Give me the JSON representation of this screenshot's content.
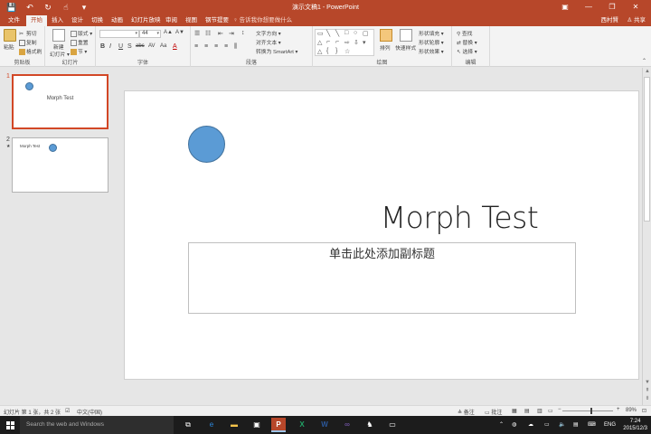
{
  "titlebar": {
    "title": "演示文稿1 - PowerPoint",
    "qat": [
      {
        "icon": "save-icon",
        "glyph": "💾"
      },
      {
        "icon": "undo-icon",
        "glyph": "↶"
      },
      {
        "icon": "redo-icon",
        "glyph": "↻"
      },
      {
        "icon": "touch-mode-icon",
        "glyph": "☝"
      },
      {
        "icon": "customize-qat-icon",
        "glyph": "▾"
      }
    ],
    "window_buttons": {
      "options": "▣",
      "minimize": "—",
      "restore": "❐",
      "close": "✕"
    }
  },
  "tabs": [
    {
      "label": "文件",
      "active": false
    },
    {
      "label": "开始",
      "active": true
    },
    {
      "label": "插入",
      "active": false
    },
    {
      "label": "设计",
      "active": false
    },
    {
      "label": "切换",
      "active": false
    },
    {
      "label": "动画",
      "active": false
    },
    {
      "label": "幻灯片放映",
      "active": false
    },
    {
      "label": "审阅",
      "active": false
    },
    {
      "label": "视图",
      "active": false
    },
    {
      "label": "钢节提要",
      "active": false
    }
  ],
  "tellme": "♀ 告诉我你想要做什么",
  "user": "西村賢",
  "share": "♙ 共享",
  "ribbon": {
    "clipboard": {
      "label": "剪贴板",
      "paste": "粘贴",
      "cut": "剪切",
      "copy": "复制",
      "format_painter": "格式刷"
    },
    "slides": {
      "label": "幻灯片",
      "new_slide": "新建",
      "new_slide_2": "幻灯片 ▾",
      "layout": "版式 ▾",
      "reset": "重置",
      "section": "节 ▾"
    },
    "font": {
      "label": "字体",
      "font_name": "",
      "font_size": "44",
      "bold": "B",
      "italic": "I",
      "underline": "U",
      "shadow": "S",
      "strike": "abc",
      "spacing": "AV",
      "case": "Aa",
      "color": "A",
      "grow": "A▲",
      "shrink": "A▼",
      "clear": "A✕"
    },
    "paragraph": {
      "label": "段落",
      "text_direction": "文字方向 ▾",
      "align_text": "对齐文本 ▾",
      "smartart": "转换为 SmartArt ▾"
    },
    "drawing": {
      "label": "绘图",
      "arrange": "排列",
      "quick_styles": "快速样式",
      "shape_fill": "形状填充 ▾",
      "shape_outline": "形状轮廓 ▾",
      "shape_effects": "形状效果 ▾"
    },
    "editing": {
      "label": "编辑",
      "find": "查找",
      "replace": "替换 ▾",
      "select": "选择 ▾"
    }
  },
  "thumbnails": [
    {
      "number": "1",
      "title": "Morph Test"
    },
    {
      "number": "2",
      "title": "Morph Test",
      "star": "★"
    }
  ],
  "slide": {
    "title": "Morph Test",
    "subtitle_placeholder": "单击此处添加副标题"
  },
  "statusbar": {
    "slide_info": "幻灯片 第 1 张，共 2 张",
    "language": "中文(中国)",
    "notes": "备注",
    "comments": "批注",
    "zoom_minus": "−",
    "zoom_plus": "+",
    "zoom": "89%",
    "zoom_level": 0.55
  },
  "taskbar": {
    "search_placeholder": "Search the web and Windows",
    "language": "ENG",
    "time": "7:24",
    "date": "2015/12/3"
  },
  "colors": {
    "accent": "#b7472a",
    "shape_fill": "#5b9bd5",
    "shape_outline": "#41719c"
  }
}
